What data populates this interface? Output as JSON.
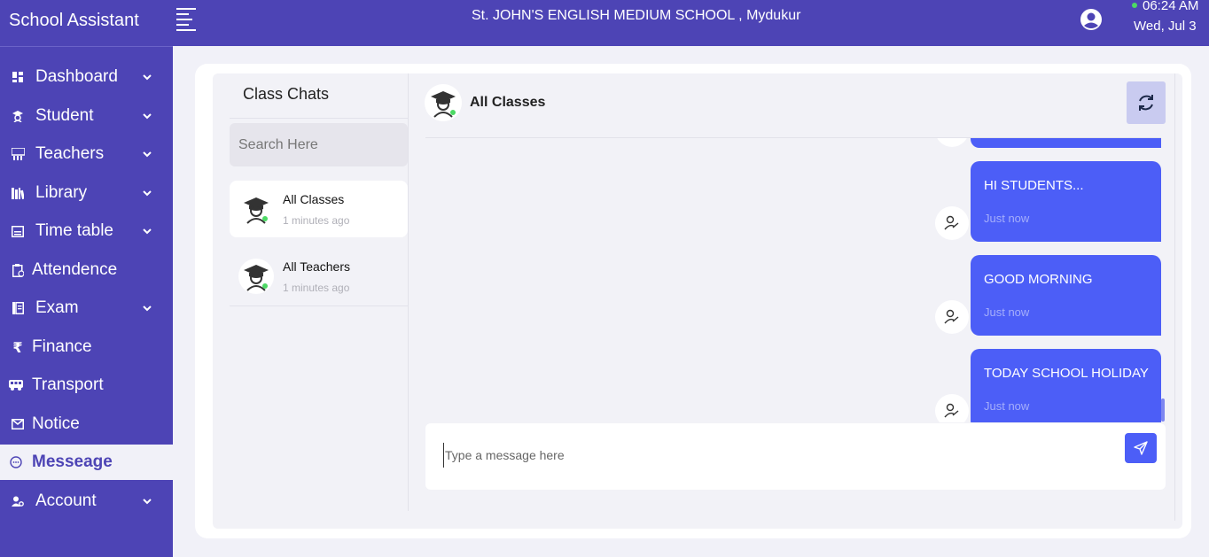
{
  "header": {
    "app_title": "School Assistant",
    "school_name": "St. JOHN'S ENGLISH MEDIUM SCHOOL , Mydukur",
    "time": "06:24 AM",
    "date": "Wed, Jul 3",
    "online_color": "#4cd964"
  },
  "sidebar": {
    "items": [
      {
        "label": "Dashboard",
        "icon": "grid-icon",
        "has_submenu": true
      },
      {
        "label": "Student",
        "icon": "graduate-icon",
        "has_submenu": true
      },
      {
        "label": "Teachers",
        "icon": "teacher-board-icon",
        "has_submenu": true
      },
      {
        "label": "Library",
        "icon": "books-icon",
        "has_submenu": true
      },
      {
        "label": "Time table",
        "icon": "calendar-icon",
        "has_submenu": true
      },
      {
        "label": "Attendence",
        "icon": "clipboard-icon",
        "has_submenu": false
      },
      {
        "label": "Exam",
        "icon": "exam-list-icon",
        "has_submenu": true
      },
      {
        "label": "Finance",
        "icon": "rupee-icon",
        "has_submenu": false
      },
      {
        "label": "Transport",
        "icon": "bus-icon",
        "has_submenu": false
      },
      {
        "label": "Notice",
        "icon": "mail-icon",
        "has_submenu": false
      },
      {
        "label": "Messeage",
        "icon": "chat-bubble-icon",
        "has_submenu": false,
        "active": true
      },
      {
        "label": "Account",
        "icon": "user-gear-icon",
        "has_submenu": true
      }
    ]
  },
  "chat_list": {
    "title": "Class Chats",
    "search_placeholder": "Search Here",
    "items": [
      {
        "name": "All Classes",
        "time": "1 minutes ago",
        "active": true
      },
      {
        "name": "All Teachers",
        "time": "1 minutes ago",
        "active": false
      }
    ]
  },
  "conversation": {
    "title": "All Classes",
    "messages": [
      {
        "text": "HI STUDENTS...",
        "time": "Just now"
      },
      {
        "text": "GOOD MORNING",
        "time": "Just now"
      },
      {
        "text": "TODAY SCHOOL HOLIDAY",
        "time": "Just now"
      }
    ],
    "input_placeholder": "Type a message here"
  },
  "colors": {
    "primary": "#4d44b5",
    "bubble": "#4c5ef7",
    "background": "#f1f1f8"
  }
}
